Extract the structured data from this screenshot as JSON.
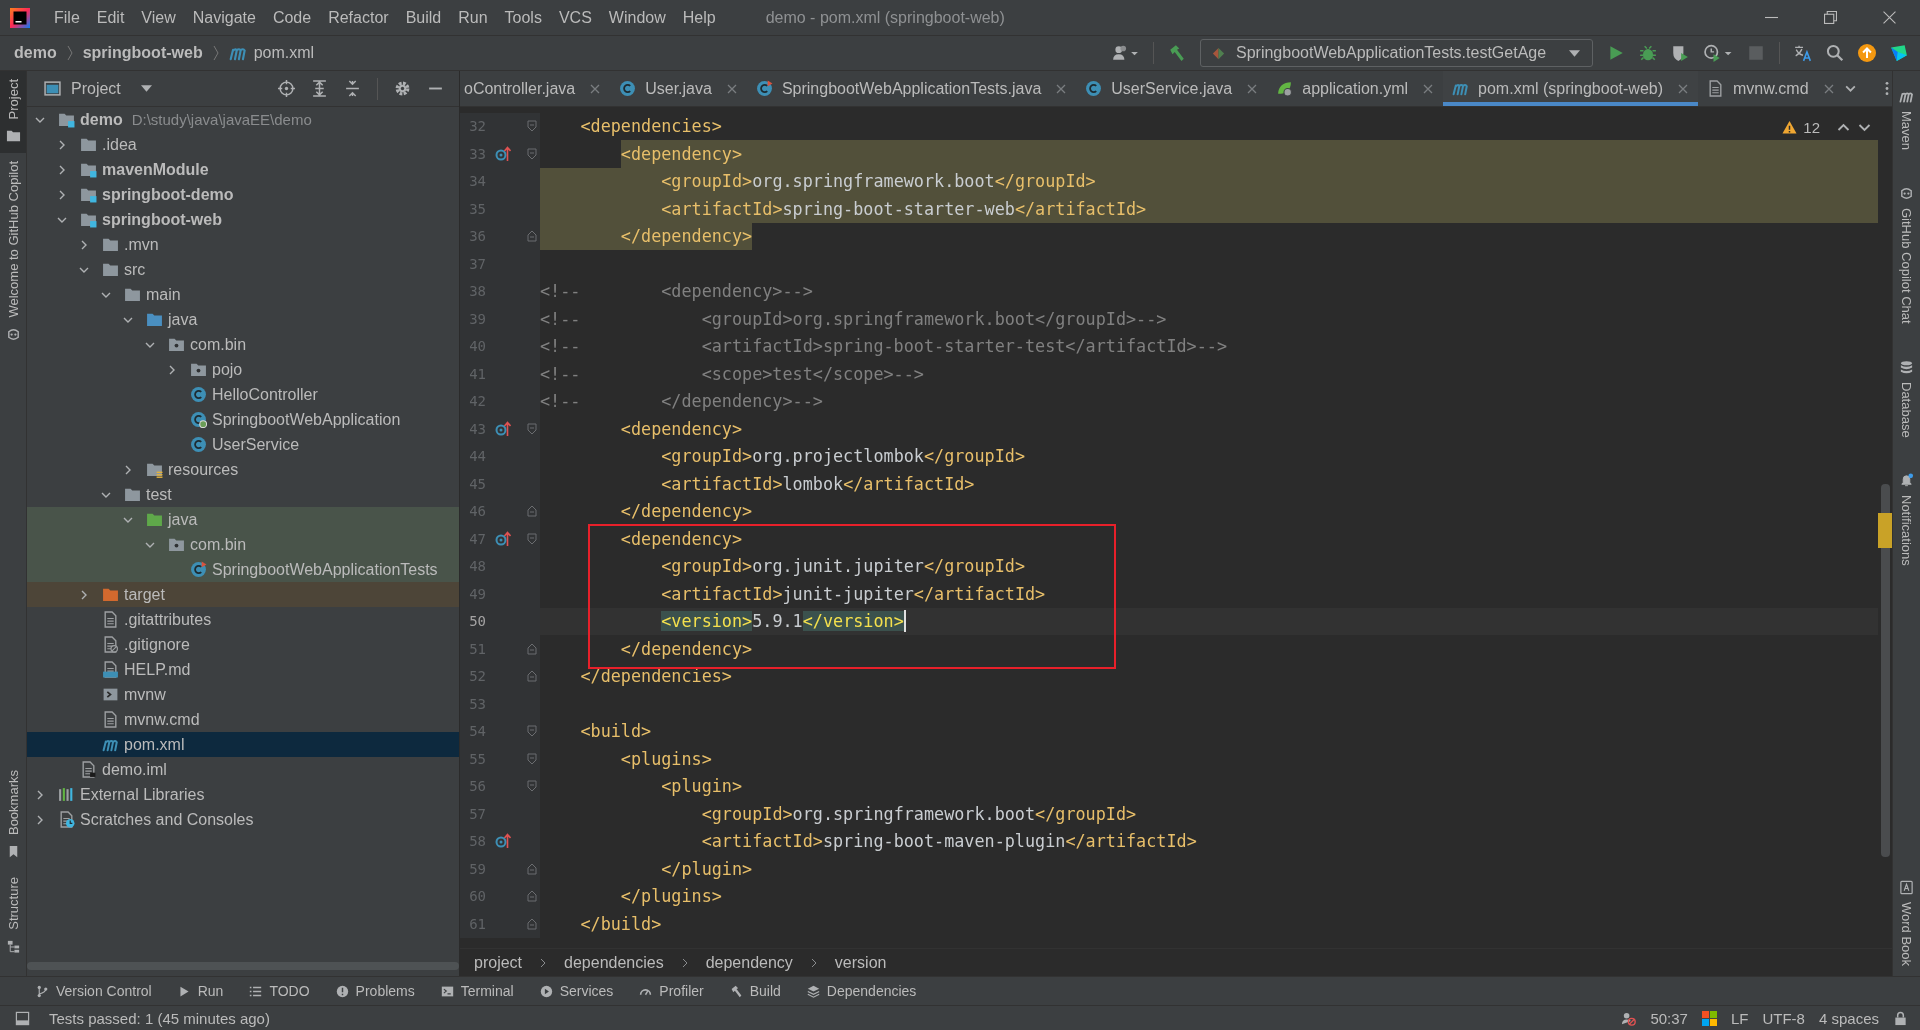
{
  "menu_bar": {
    "items": [
      "File",
      "Edit",
      "View",
      "Navigate",
      "Code",
      "Refactor",
      "Build",
      "Run",
      "Tools",
      "VCS",
      "Window",
      "Help"
    ],
    "title": "demo - pom.xml (springboot-web)"
  },
  "navigation_bar": {
    "breadcrumb": [
      {
        "label": "demo",
        "kind": "module"
      },
      {
        "label": "springboot-web",
        "kind": "module"
      },
      {
        "label": "pom.xml",
        "kind": "maven"
      }
    ],
    "run_configuration": "SpringbootWebApplicationTests.testGetAge"
  },
  "left_tool_strip": [
    {
      "label": "Project",
      "kind": "project",
      "selected": true
    },
    {
      "label": "Welcome to GitHub Copilot",
      "kind": "copilot",
      "selected": false
    },
    {
      "label": "Bookmarks",
      "kind": "bookmarks",
      "selected": false
    },
    {
      "label": "Structure",
      "kind": "structure",
      "selected": false
    }
  ],
  "project_panel": {
    "title": "Project",
    "tree": [
      {
        "label": "demo",
        "kind": "module",
        "path": "D:\\study\\java\\javaEE\\demo",
        "expanded": true,
        "selected": false,
        "children": [
          {
            "label": ".idea",
            "kind": "folder",
            "expanded": false,
            "selected": false
          },
          {
            "label": "mavenModule",
            "kind": "module",
            "expanded": false,
            "selected": false
          },
          {
            "label": "springboot-demo",
            "kind": "module",
            "expanded": false,
            "selected": false
          },
          {
            "label": "springboot-web",
            "kind": "module",
            "expanded": true,
            "selected": false,
            "children": [
              {
                "label": ".mvn",
                "kind": "folder",
                "expanded": false,
                "selected": false
              },
              {
                "label": "src",
                "kind": "folder",
                "expanded": true,
                "selected": false,
                "children": [
                  {
                    "label": "main",
                    "kind": "folder",
                    "expanded": true,
                    "selected": false,
                    "children": [
                      {
                        "label": "java",
                        "kind": "source-root",
                        "expanded": true,
                        "selected": false,
                        "children": [
                          {
                            "label": "com.bin",
                            "kind": "package",
                            "expanded": true,
                            "selected": false,
                            "children": [
                              {
                                "label": "pojo",
                                "kind": "package",
                                "expanded": false,
                                "selected": false
                              },
                              {
                                "label": "HelloController",
                                "kind": "class",
                                "selected": false
                              },
                              {
                                "label": "SpringbootWebApplication",
                                "kind": "spring-class",
                                "selected": false
                              },
                              {
                                "label": "UserService",
                                "kind": "class",
                                "selected": false
                              }
                            ]
                          }
                        ]
                      },
                      {
                        "label": "resources",
                        "kind": "resources-root",
                        "expanded": false,
                        "selected": false
                      }
                    ]
                  },
                  {
                    "label": "test",
                    "kind": "folder",
                    "expanded": true,
                    "selected": false,
                    "children": [
                      {
                        "label": "java",
                        "kind": "test-root",
                        "expanded": true,
                        "selected": false,
                        "children": [
                          {
                            "label": "com.bin",
                            "kind": "package",
                            "expanded": true,
                            "selected": false,
                            "children": [
                              {
                                "label": "SpringbootWebApplicationTests",
                                "kind": "test-class",
                                "selected": false
                              }
                            ]
                          }
                        ]
                      }
                    ]
                  }
                ]
              },
              {
                "label": "target",
                "kind": "excluded",
                "expanded": false,
                "selected": false
              },
              {
                "label": ".gitattributes",
                "kind": "file",
                "selected": false
              },
              {
                "label": ".gitignore",
                "kind": "ignore-file",
                "selected": false
              },
              {
                "label": "HELP.md",
                "kind": "markdown",
                "selected": false
              },
              {
                "label": "mvnw",
                "kind": "script",
                "selected": false
              },
              {
                "label": "mvnw.cmd",
                "kind": "file",
                "selected": false
              },
              {
                "label": "pom.xml",
                "kind": "maven",
                "selected": true
              }
            ]
          },
          {
            "label": "demo.iml",
            "kind": "iml",
            "selected": false
          }
        ]
      },
      {
        "label": "External Libraries",
        "kind": "libraries",
        "expanded": false,
        "selected": false
      },
      {
        "label": "Scratches and Consoles",
        "kind": "scratches",
        "expanded": false,
        "selected": false
      }
    ]
  },
  "editor_tabs": [
    {
      "label": "oController.java",
      "kind": "clipped",
      "selected": false
    },
    {
      "label": "User.java",
      "kind": "class",
      "selected": false
    },
    {
      "label": "SpringbootWebApplicationTests.java",
      "kind": "test-class",
      "selected": false
    },
    {
      "label": "UserService.java",
      "kind": "class",
      "selected": false
    },
    {
      "label": "application.yml",
      "kind": "yaml",
      "selected": false
    },
    {
      "label": "pom.xml (springboot-web)",
      "kind": "maven",
      "selected": true
    },
    {
      "label": "mvnw.cmd",
      "kind": "file",
      "selected": false
    }
  ],
  "editor": {
    "warning_count": "12",
    "lines": [
      {
        "number": "32",
        "kind": "fold-start",
        "tokens": [
          {
            "text": "    <dependencies>",
            "kind": "tag"
          }
        ],
        "highlighted": false,
        "gutter_mark": false,
        "boxed": false,
        "current": false
      },
      {
        "number": "33",
        "kind": "fold-start",
        "tokens": [
          {
            "text": "        <dependency>",
            "kind": "tag"
          }
        ],
        "highlighted": true,
        "gutter_mark": true,
        "boxed": false,
        "current": false
      },
      {
        "number": "34",
        "kind": "plain",
        "tokens": [
          {
            "text": "            <groupId>",
            "kind": "tag"
          },
          {
            "text": "org.springframework.boot",
            "kind": "text"
          },
          {
            "text": "</groupId>",
            "kind": "tag"
          }
        ],
        "highlighted": true,
        "gutter_mark": false,
        "boxed": false,
        "current": false
      },
      {
        "number": "35",
        "kind": "plain",
        "tokens": [
          {
            "text": "            <artifactId>",
            "kind": "tag"
          },
          {
            "text": "spring-boot-starter-web",
            "kind": "text"
          },
          {
            "text": "</artifactId>",
            "kind": "tag"
          }
        ],
        "highlighted": true,
        "gutter_mark": false,
        "boxed": false,
        "current": false
      },
      {
        "number": "36",
        "kind": "fold-end",
        "tokens": [
          {
            "text": "        </dependency>",
            "kind": "tag"
          }
        ],
        "highlighted": true,
        "gutter_mark": false,
        "boxed": false,
        "current": false
      },
      {
        "number": "37",
        "kind": "plain",
        "highlighted": false,
        "gutter_mark": false,
        "boxed": false,
        "current": false
      },
      {
        "number": "38",
        "kind": "plain",
        "tokens": [
          {
            "text": "<!--        <dependency>-->",
            "kind": "comment"
          }
        ],
        "highlighted": false,
        "gutter_mark": false,
        "boxed": false,
        "current": false
      },
      {
        "number": "39",
        "kind": "plain",
        "tokens": [
          {
            "text": "<!--            <groupId>org.springframework.boot</groupId>-->",
            "kind": "comment"
          }
        ],
        "highlighted": false,
        "gutter_mark": false,
        "boxed": false,
        "current": false
      },
      {
        "number": "40",
        "kind": "plain",
        "tokens": [
          {
            "text": "<!--            <artifactId>spring-boot-starter-test</artifactId>-->",
            "kind": "comment"
          }
        ],
        "highlighted": false,
        "gutter_mark": false,
        "boxed": false,
        "current": false
      },
      {
        "number": "41",
        "kind": "plain",
        "tokens": [
          {
            "text": "<!--            <scope>test</scope>-->",
            "kind": "comment"
          }
        ],
        "highlighted": false,
        "gutter_mark": false,
        "boxed": false,
        "current": false
      },
      {
        "number": "42",
        "kind": "plain",
        "tokens": [
          {
            "text": "<!--        </dependency>-->",
            "kind": "comment"
          }
        ],
        "highlighted": false,
        "gutter_mark": false,
        "boxed": false,
        "current": false
      },
      {
        "number": "43",
        "kind": "fold-start",
        "tokens": [
          {
            "text": "        <dependency>",
            "kind": "tag"
          }
        ],
        "highlighted": false,
        "gutter_mark": true,
        "boxed": false,
        "current": false
      },
      {
        "number": "44",
        "kind": "plain",
        "tokens": [
          {
            "text": "            <groupId>",
            "kind": "tag"
          },
          {
            "text": "org.projectlombok",
            "kind": "text"
          },
          {
            "text": "</groupId>",
            "kind": "tag"
          }
        ],
        "highlighted": false,
        "gutter_mark": false,
        "boxed": false,
        "current": false
      },
      {
        "number": "45",
        "kind": "plain",
        "tokens": [
          {
            "text": "            <artifactId>",
            "kind": "tag"
          },
          {
            "text": "lombok",
            "kind": "text"
          },
          {
            "text": "</artifactId>",
            "kind": "tag"
          }
        ],
        "highlighted": false,
        "gutter_mark": false,
        "boxed": false,
        "current": false
      },
      {
        "number": "46",
        "kind": "fold-end",
        "tokens": [
          {
            "text": "        </dependency>",
            "kind": "tag"
          }
        ],
        "highlighted": false,
        "gutter_mark": false,
        "boxed": false,
        "current": false
      },
      {
        "number": "47",
        "kind": "fold-start",
        "tokens": [
          {
            "text": "        <dependency>",
            "kind": "tag"
          }
        ],
        "highlighted": false,
        "gutter_mark": true,
        "boxed": true,
        "current": false
      },
      {
        "number": "48",
        "kind": "plain",
        "tokens": [
          {
            "text": "            <groupId>",
            "kind": "tag"
          },
          {
            "text": "org.junit.jupiter",
            "kind": "text"
          },
          {
            "text": "</groupId>",
            "kind": "tag"
          }
        ],
        "highlighted": false,
        "gutter_mark": false,
        "boxed": true,
        "current": false
      },
      {
        "number": "49",
        "kind": "plain",
        "tokens": [
          {
            "text": "            <artifactId>",
            "kind": "tag"
          },
          {
            "text": "junit-jupiter",
            "kind": "text"
          },
          {
            "text": "</artifactId>",
            "kind": "tag"
          }
        ],
        "highlighted": false,
        "gutter_mark": false,
        "boxed": true,
        "current": false
      },
      {
        "number": "50",
        "kind": "plain",
        "tokens": [
          {
            "text": "            <version>",
            "kind": "matched-tag"
          },
          {
            "text": "5.9.1",
            "kind": "text"
          },
          {
            "text": "</version>",
            "kind": "matched-tag"
          }
        ],
        "highlighted": false,
        "gutter_mark": false,
        "boxed": true,
        "current": true
      },
      {
        "number": "51",
        "kind": "fold-end",
        "tokens": [
          {
            "text": "        </dependency>",
            "kind": "tag"
          }
        ],
        "highlighted": false,
        "gutter_mark": false,
        "boxed": true,
        "current": false
      },
      {
        "number": "52",
        "kind": "fold-end",
        "tokens": [
          {
            "text": "    </dependencies>",
            "kind": "tag"
          }
        ],
        "highlighted": false,
        "gutter_mark": false,
        "boxed": false,
        "current": false
      },
      {
        "number": "53",
        "kind": "plain",
        "highlighted": false,
        "gutter_mark": false,
        "boxed": false,
        "current": false
      },
      {
        "number": "54",
        "kind": "fold-start",
        "tokens": [
          {
            "text": "    <build>",
            "kind": "tag"
          }
        ],
        "highlighted": false,
        "gutter_mark": false,
        "boxed": false,
        "current": false
      },
      {
        "number": "55",
        "kind": "fold-start",
        "tokens": [
          {
            "text": "        <plugins>",
            "kind": "tag"
          }
        ],
        "highlighted": false,
        "gutter_mark": false,
        "boxed": false,
        "current": false
      },
      {
        "number": "56",
        "kind": "fold-start",
        "tokens": [
          {
            "text": "            <plugin>",
            "kind": "tag"
          }
        ],
        "highlighted": false,
        "gutter_mark": false,
        "boxed": false,
        "current": false
      },
      {
        "number": "57",
        "kind": "plain",
        "tokens": [
          {
            "text": "                <groupId>",
            "kind": "tag"
          },
          {
            "text": "org.springframework.boot",
            "kind": "text"
          },
          {
            "text": "</groupId>",
            "kind": "tag"
          }
        ],
        "highlighted": false,
        "gutter_mark": false,
        "boxed": false,
        "current": false
      },
      {
        "number": "58",
        "kind": "plain",
        "tokens": [
          {
            "text": "                <artifactId>",
            "kind": "tag"
          },
          {
            "text": "spring-boot-maven-plugin",
            "kind": "text"
          },
          {
            "text": "</artifactId>",
            "kind": "tag"
          }
        ],
        "highlighted": false,
        "gutter_mark": true,
        "boxed": false,
        "current": false
      },
      {
        "number": "59",
        "kind": "fold-end",
        "tokens": [
          {
            "text": "            </plugin>",
            "kind": "tag"
          }
        ],
        "highlighted": false,
        "gutter_mark": false,
        "boxed": false,
        "current": false
      },
      {
        "number": "60",
        "kind": "fold-end",
        "tokens": [
          {
            "text": "        </plugins>",
            "kind": "tag"
          }
        ],
        "highlighted": false,
        "gutter_mark": false,
        "boxed": false,
        "current": false
      },
      {
        "number": "61",
        "kind": "fold-end",
        "tokens": [
          {
            "text": "    </build>",
            "kind": "tag"
          }
        ],
        "highlighted": false,
        "gutter_mark": false,
        "boxed": false,
        "current": false
      }
    ]
  },
  "editor_breadcrumb": [
    "project",
    "dependencies",
    "dependency",
    "version"
  ],
  "right_tool_strip": [
    {
      "label": "Maven",
      "kind": "maven"
    },
    {
      "label": "GitHub Copilot Chat",
      "kind": "copilot"
    },
    {
      "label": "Database",
      "kind": "database"
    },
    {
      "label": "Notifications",
      "kind": "notifications"
    },
    {
      "label": "Word Book",
      "kind": "word-book"
    }
  ],
  "bottom_tool_bar": [
    {
      "label": "Version Control",
      "kind": "vcs"
    },
    {
      "label": "Run",
      "kind": "run"
    },
    {
      "label": "TODO",
      "kind": "todo"
    },
    {
      "label": "Problems",
      "kind": "problems"
    },
    {
      "label": "Terminal",
      "kind": "terminal"
    },
    {
      "label": "Services",
      "kind": "services"
    },
    {
      "label": "Profiler",
      "kind": "profiler"
    },
    {
      "label": "Build",
      "kind": "build"
    },
    {
      "label": "Dependencies",
      "kind": "dependencies"
    }
  ],
  "status_bar": {
    "message": "Tests passed: 1 (45 minutes ago)",
    "caret_position": "50:37",
    "line_separator": "LF",
    "encoding": "UTF-8",
    "indent": "4 spaces"
  }
}
